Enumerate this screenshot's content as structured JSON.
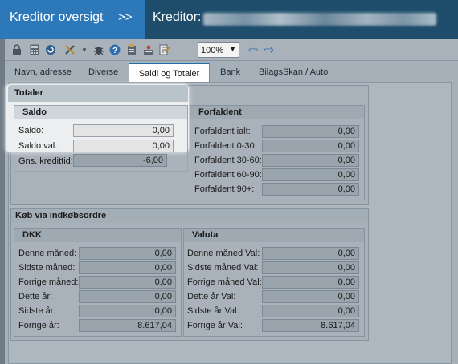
{
  "header": {
    "left_title": "Kreditor oversigt",
    "chevrons": ">>",
    "right_title": "Kreditor:"
  },
  "toolbar": {
    "zoom_value": "100%",
    "icons": [
      "lock-icon",
      "calculator-icon",
      "refresh-icon",
      "tools-icon",
      "dropdown-icon",
      "bug-icon",
      "help-icon",
      "clipboard-icon",
      "user-card-icon",
      "notes-icon",
      "arrow-left-icon",
      "arrow-right-icon"
    ]
  },
  "tabs": [
    {
      "label": "Navn, adresse"
    },
    {
      "label": "Diverse"
    },
    {
      "label": "Saldi og Totaler",
      "active": true
    },
    {
      "label": "Bank"
    },
    {
      "label": "BilagsSkan / Auto"
    }
  ],
  "totaler": {
    "title": "Totaler",
    "saldo": {
      "title": "Saldo",
      "rows": [
        {
          "label": "Saldo:",
          "value": "0,00"
        },
        {
          "label": "Saldo val.:",
          "value": "0,00"
        },
        {
          "label": "Gns. kredittid:",
          "value": "-6,00"
        }
      ]
    },
    "forfaldent": {
      "title": "Forfaldent",
      "rows": [
        {
          "label": "Forfaldent ialt:",
          "value": "0,00"
        },
        {
          "label": "Forfaldent 0-30:",
          "value": "0,00"
        },
        {
          "label": "Forfaldent 30-60:",
          "value": "0,00"
        },
        {
          "label": "Forfaldent 60-90:",
          "value": "0,00"
        },
        {
          "label": "Forfaldent 90+:",
          "value": "0,00"
        }
      ]
    }
  },
  "koeb": {
    "title": "Køb via indkøbsordre",
    "dkk": {
      "title": "DKK",
      "rows": [
        {
          "label": "Denne måned:",
          "value": "0,00"
        },
        {
          "label": "Sidste måned:",
          "value": "0,00"
        },
        {
          "label": "Forrige måned:",
          "value": "0,00"
        },
        {
          "label": "Dette år:",
          "value": "0,00"
        },
        {
          "label": "Sidste år:",
          "value": "0,00"
        },
        {
          "label": "Forrige år:",
          "value": "8.617,04"
        }
      ]
    },
    "valuta": {
      "title": "Valuta",
      "rows": [
        {
          "label": "Denne måned Val:",
          "value": "0,00"
        },
        {
          "label": "Sidste måned Val:",
          "value": "0,00"
        },
        {
          "label": "Forrige måned Val:",
          "value": "0,00"
        },
        {
          "label": "Dette år Val:",
          "value": "0,00"
        },
        {
          "label": "Sidste år Val:",
          "value": "0,00"
        },
        {
          "label": "Forrige år Val:",
          "value": "8.617,04"
        }
      ]
    }
  }
}
